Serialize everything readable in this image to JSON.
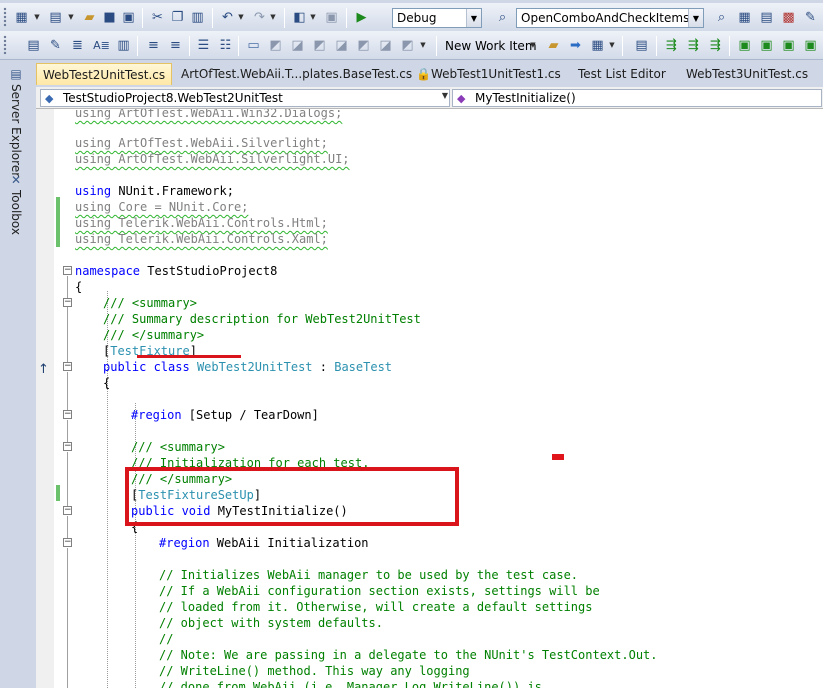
{
  "toolbar1": {
    "configuration": "Debug",
    "find_combo": "OpenComboAndCheckItems",
    "icons": [
      "new-project-icon",
      "add-item-icon",
      "open-file-icon",
      "save-icon",
      "save-all-icon",
      "cut-icon",
      "copy-icon",
      "paste-icon",
      "undo-icon",
      "redo-icon",
      "navigate-icon",
      "nav-forward-icon",
      "start-debug-icon",
      "find-icon",
      "solution-explorer-icon",
      "properties-icon",
      "object-browser-icon",
      "toolbox-icon",
      "start-page-icon"
    ]
  },
  "toolbar2": {
    "new_work_item": "New Work Item"
  },
  "side_tabs": {
    "server_explorer": "Server Explorer",
    "toolbox": "Toolbox"
  },
  "doc_tabs": [
    {
      "label": "WebTest2UnitTest.cs",
      "active": true
    },
    {
      "label": "ArtOfTest.WebAii.T...plates.BaseTest.cs 🔒",
      "active": false
    },
    {
      "label": "WebTest1UnitTest1.cs",
      "active": false
    },
    {
      "label": "Test List Editor",
      "active": false
    },
    {
      "label": "WebTest3UnitTest.cs",
      "active": false
    }
  ],
  "nav": {
    "type_combo": "TestStudioProject8.WebTest2UnitTest",
    "member_combo": "MyTestInitialize()"
  },
  "code": {
    "l1": "using ArtOfTest.WebAii.Win32.Dialogs;",
    "l2": "using ArtOfTest.WebAii.Silverlight;",
    "l3": "using ArtOfTest.WebAii.Silverlight.UI;",
    "l4_kw": "using",
    "l4_rest": " NUnit.Framework;",
    "l5": "using Core = NUnit.Core;",
    "l6": "using Telerik.WebAii.Controls.Html;",
    "l7": "using Telerik.WebAii.Controls.Xaml;",
    "ns_kw": "namespace",
    "ns_name": " TestStudioProject8",
    "brace_open": "{",
    "sum1": "/// <summary>",
    "sum2": "/// Summary description for WebTest2UnitTest",
    "sum3": "/// </summary>",
    "attr_fixture": "TestFixture",
    "class_kw": "public class",
    "class_name": "WebTest2UnitTest",
    "class_colon": " : ",
    "class_base": "BaseTest",
    "region1": "#region",
    "region1_name": " [Setup / TearDown]",
    "init_sum1": "/// <summary>",
    "init_sum2": "/// Initialization for each test.",
    "init_sum3": "/// </summary>",
    "attr_setup": "TestFixtureSetUp",
    "method_kw": "public void",
    "method_name": " MyTestInitialize()",
    "region2": "#region",
    "region2_name": " WebAii Initialization",
    "c1": "// Initializes WebAii manager to be used by the test case.",
    "c2": "// If a WebAii configuration section exists, settings will be",
    "c3": "// loaded from it. Otherwise, will create a default settings",
    "c4": "// object with system defaults.",
    "c5": "//",
    "c6": "// Note: We are passing in a delegate to the NUnit's TestContext.Out.",
    "c7": "// WriteLine() method. This way any logging",
    "c8": "// done from WebAii (i.e. Manager.Log.WriteLine()) is"
  },
  "colors": {
    "keyword": "#0000ff",
    "type": "#2b91af",
    "comment": "#008000",
    "annotation": "#d9141b"
  }
}
